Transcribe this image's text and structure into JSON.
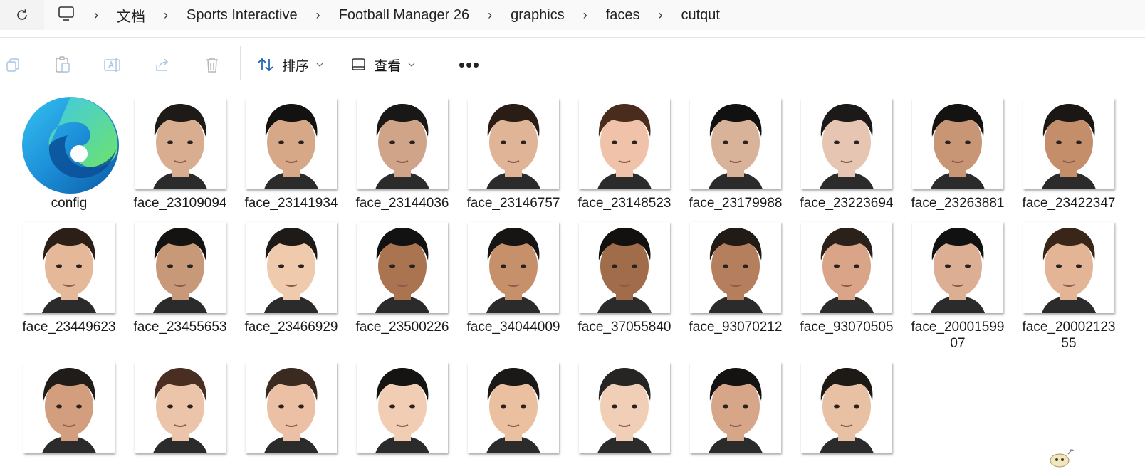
{
  "address_bar": {
    "breadcrumbs": [
      "文档",
      "Sports Interactive",
      "Football Manager 26",
      "graphics",
      "faces",
      "cutqut"
    ]
  },
  "toolbar": {
    "sort_label": "排序",
    "view_label": "查看",
    "more_label": "•••"
  },
  "files": [
    {
      "name": "config",
      "type": "edge-document",
      "skin": "",
      "hair": ""
    },
    {
      "name": "face_23109094",
      "skin": "#d9ad8f",
      "hair": "#1e1a17"
    },
    {
      "name": "face_23141934",
      "skin": "#d6a887",
      "hair": "#141211"
    },
    {
      "name": "face_23144036",
      "skin": "#cfa488",
      "hair": "#1a1816"
    },
    {
      "name": "face_23146757",
      "skin": "#e0b497",
      "hair": "#2a1d16"
    },
    {
      "name": "face_23148523",
      "skin": "#f0c2a9",
      "hair": "#4a2c1c"
    },
    {
      "name": "face_23179988",
      "skin": "#d9b29a",
      "hair": "#121111"
    },
    {
      "name": "face_23223694",
      "skin": "#e6c6b2",
      "hair": "#1c1a18"
    },
    {
      "name": "face_23263881",
      "skin": "#c99675",
      "hair": "#151312"
    },
    {
      "name": "face_23422347",
      "skin": "#c48e6a",
      "hair": "#1a1714"
    },
    {
      "name": "face_23449623",
      "skin": "#e5b89a",
      "hair": "#2b1f18"
    },
    {
      "name": "face_23455653",
      "skin": "#c89978",
      "hair": "#141312"
    },
    {
      "name": "face_23466929",
      "skin": "#f0caac",
      "hair": "#1d1a18"
    },
    {
      "name": "face_23500226",
      "skin": "#a9744f",
      "hair": "#131212"
    },
    {
      "name": "face_34044009",
      "skin": "#c6906b",
      "hair": "#161514"
    },
    {
      "name": "face_37055840",
      "skin": "#a06c4a",
      "hair": "#121110"
    },
    {
      "name": "face_93070212",
      "skin": "#b57f5e",
      "hair": "#221a15"
    },
    {
      "name": "face_93070505",
      "skin": "#d9a488",
      "hair": "#2a211b"
    },
    {
      "name": "face_2000159907",
      "skin": "#dcae93",
      "hair": "#121111"
    },
    {
      "name": "face_2000212355",
      "skin": "#e3b596",
      "hair": "#3a2619"
    },
    {
      "name": "",
      "skin": "#d29e7d",
      "hair": "#1f1c1a"
    },
    {
      "name": "",
      "skin": "#ebc4aa",
      "hair": "#4a2e22"
    },
    {
      "name": "",
      "skin": "#ecc0a4",
      "hair": "#3a2a20"
    },
    {
      "name": "",
      "skin": "#f0cdb3",
      "hair": "#161412"
    },
    {
      "name": "",
      "skin": "#ebc0a0",
      "hair": "#1b1918"
    },
    {
      "name": "",
      "skin": "#f1cfb7",
      "hair": "#262523"
    },
    {
      "name": "",
      "skin": "#d7a688",
      "hair": "#141312"
    },
    {
      "name": "",
      "skin": "#e8c0a4",
      "hair": "#1d1a16"
    }
  ]
}
